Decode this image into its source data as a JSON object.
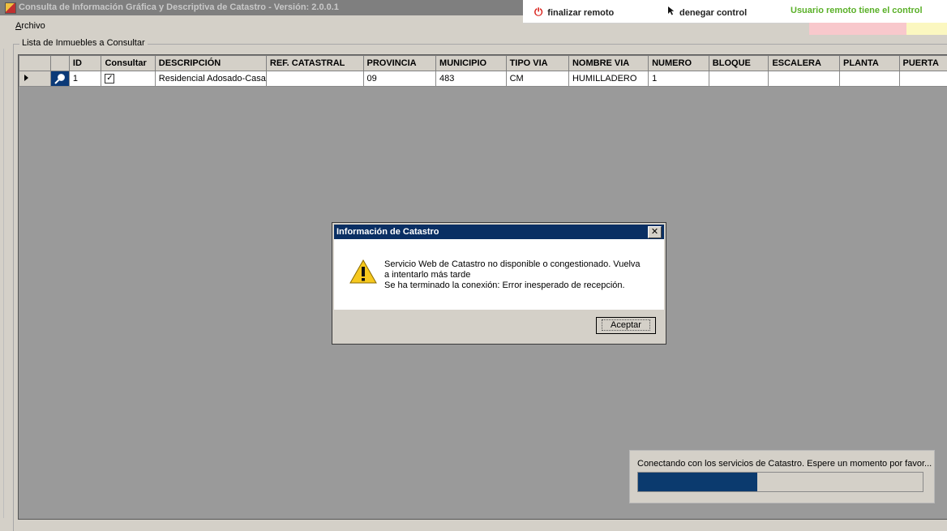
{
  "window": {
    "title": "Consulta de Información Gráfica y Descriptiva de Catastro - Versión: 2.0.0.1"
  },
  "remote": {
    "finish_label": "finalizar remoto",
    "deny_label": "denegar control",
    "status_label": "Usuario remoto tiene el control",
    "finish_icon": "power-icon",
    "deny_icon": "cursor-arrow-icon",
    "status_color": "#5ab028"
  },
  "menu": {
    "archivo_first": "A",
    "archivo_rest": "rchivo"
  },
  "group": {
    "legend": "Lista de Inmuebles a Consultar"
  },
  "grid": {
    "headers": [
      "ID",
      "Consultar",
      "DESCRIPCIÓN",
      "REF. CATASTRAL",
      "PROVINCIA",
      "MUNICIPIO",
      "TIPO VIA",
      "NOMBRE VIA",
      "NUMERO",
      "BLOQUE",
      "ESCALERA",
      "PLANTA",
      "PUERTA"
    ],
    "row": {
      "id": "1",
      "consultar": true,
      "descripcion": "Residencial Adosado-Casa",
      "ref_catastral": "",
      "provincia": "09",
      "municipio": "483",
      "tipo_via": "CM",
      "nombre_via": "HUMILLADERO",
      "numero": "1",
      "bloque": "",
      "escalera": "",
      "planta": "",
      "puerta": ""
    }
  },
  "dialog": {
    "title": "Información de Catastro",
    "close_glyph": "✕",
    "line1": "Servicio Web de Catastro  no disponible o congestionado. Vuelva",
    "line2": "a intentarlo más tarde",
    "line3": "Se ha terminado la conexión: Error inesperado de recepción.",
    "ok_label": "Aceptar",
    "icon": "warning-icon"
  },
  "progress": {
    "text": "Conectando con los servicios de Catastro. Espere un momento por favor...",
    "fraction": 0.42,
    "color": "#0b3a6e"
  }
}
